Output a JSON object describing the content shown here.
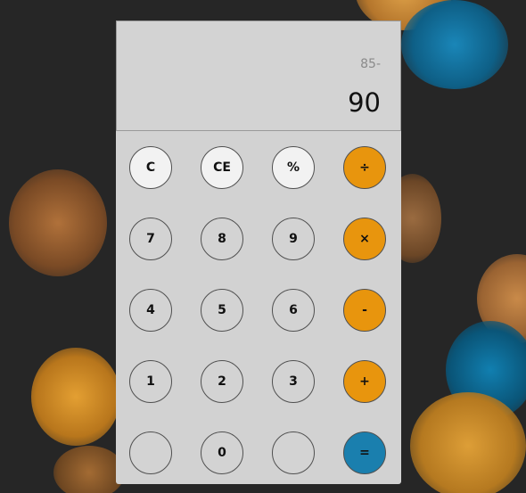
{
  "display": {
    "expression": "85-",
    "result": "90"
  },
  "keys": {
    "clear": "C",
    "clear_entry": "CE",
    "percent": "%",
    "divide": "÷",
    "seven": "7",
    "eight": "8",
    "nine": "9",
    "multiply": "×",
    "four": "4",
    "five": "5",
    "six": "6",
    "subtract": "-",
    "one": "1",
    "two": "2",
    "three": "3",
    "add": "+",
    "blank_left": "",
    "zero": "0",
    "blank_right": "",
    "equals": "="
  },
  "colors": {
    "body": "#d2d2d2",
    "utility_key": "#f2f2f2",
    "number_key": "#d3d3d3",
    "operator_key": "#e8950d",
    "equals_key": "#1a7fae",
    "background": "#262626"
  }
}
